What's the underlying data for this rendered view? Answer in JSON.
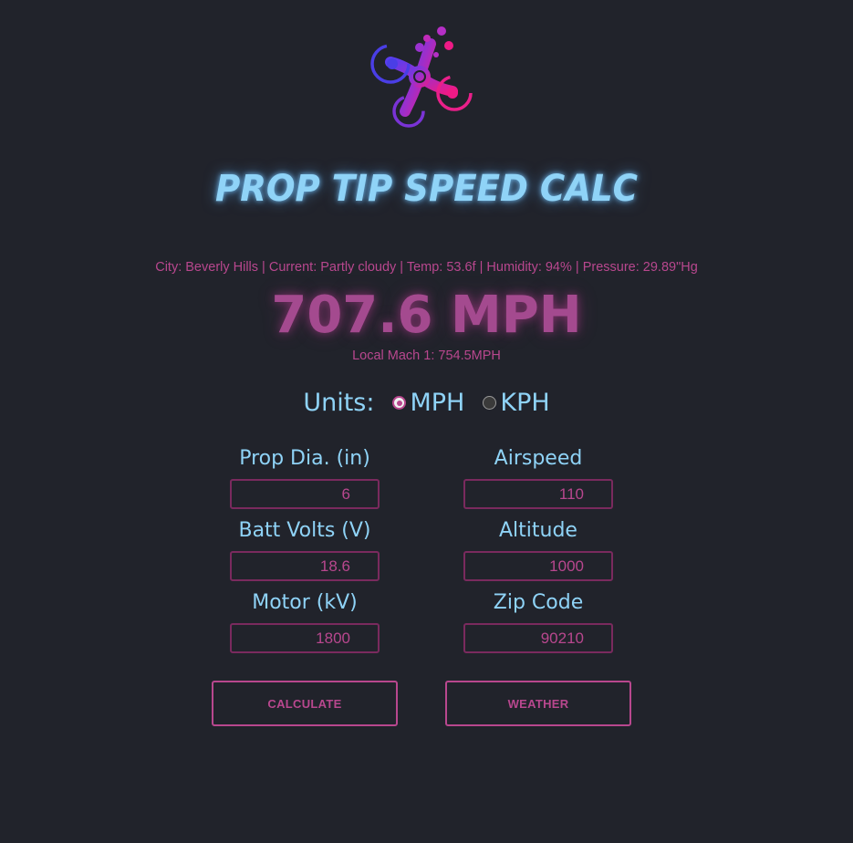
{
  "title": "PROP TIP SPEED CALC",
  "weather": {
    "line": "City: Beverly Hills | Current: Partly cloudy | Temp: 53.6f | Humidity: 94% | Pressure: 29.89\"Hg"
  },
  "result": {
    "speed": "707.6 MPH",
    "mach": "Local Mach 1: 754.5MPH"
  },
  "units": {
    "label": "Units:",
    "options": [
      {
        "label": "MPH",
        "selected": true
      },
      {
        "label": "KPH",
        "selected": false
      }
    ]
  },
  "fields": {
    "prop_dia": {
      "label": "Prop Dia. (in)",
      "value": "6"
    },
    "airspeed": {
      "label": "Airspeed",
      "value": "110"
    },
    "batt_volts": {
      "label": "Batt Volts (V)",
      "value": "18.6"
    },
    "altitude": {
      "label": "Altitude",
      "value": "1000"
    },
    "motor_kv": {
      "label": "Motor (kV)",
      "value": "1800"
    },
    "zip_code": {
      "label": "Zip Code",
      "value": "90210"
    }
  },
  "buttons": {
    "calculate": "CALCULATE",
    "weather": "WEATHER"
  },
  "colors": {
    "background": "#21232b",
    "accent_pink": "#b8478e",
    "accent_blue": "#8fd3f7"
  },
  "icons": {
    "logo": "drone-logo-icon"
  }
}
